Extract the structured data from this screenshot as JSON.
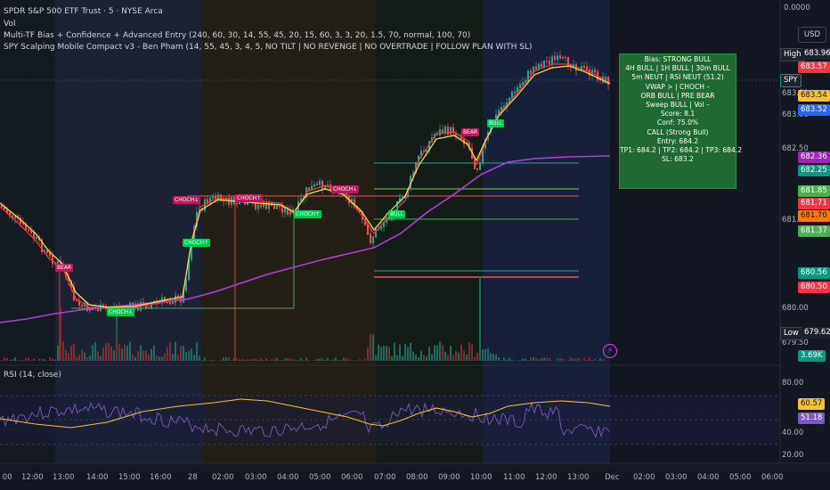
{
  "header": {
    "symbol_title": "SPDR S&P 500 ETF Trust · 5 · NYSE Arca",
    "vol_label": "Vol",
    "indicator1": "Multi-TF Bias + Confidence + Advanced Entry (240, 60, 30, 14, 55, 45, 20, 15, 60, 3, 3, 20, 1.5, 70, normal, 100, 70)",
    "indicator2": "SPY Scalping Mobile Compact v3 - Ben Pham (14, 55, 45, 3, 4, 5, NO TILT | NO REVENGE | NO OVERTRADE | FOLLOW PLAN WITH SL)"
  },
  "top_right": {
    "top_value": "0.0000",
    "currency": "USD"
  },
  "price_axis": {
    "ticks": [
      "683.50",
      "683.00",
      "682.50",
      "681.00",
      "680.00",
      "679.50"
    ],
    "high_label": "High",
    "high_value": "683.96",
    "symbol_label": "SPY",
    "symbol_value": "683.54",
    "low_label": "Low",
    "low_value": "679.62",
    "badges": [
      {
        "value": "683.57",
        "color": "#f23645"
      },
      {
        "value": "683.54",
        "color": "#fbc02d"
      },
      {
        "value": "683.52",
        "color": "#2962ff"
      },
      {
        "value": "682.36",
        "color": "#9c27b0"
      },
      {
        "value": "682.25",
        "color": "#089981"
      },
      {
        "value": "681.85",
        "color": "#4caf50"
      },
      {
        "value": "681.71",
        "color": "#f23645"
      },
      {
        "value": "681.70",
        "color": "#f57c00"
      },
      {
        "value": "681.37",
        "color": "#4caf50"
      },
      {
        "value": "680.56",
        "color": "#089981"
      },
      {
        "value": "680.50",
        "color": "#f23645"
      }
    ],
    "volume_value": "3.69K"
  },
  "signal_panel": {
    "lines": [
      "Bias: STRONG BULL",
      "4H BULL | 1H BULL | 30m BULL",
      "5m NEUT | RSI NEUT (51.2)",
      "VWAP > | CHOCH –",
      "ORB BULL | PRE BEAR",
      "Sweep BULL | Vol –",
      "Score: 8.1",
      "Conf: 75.0%",
      "CALL (Strong Bull)",
      "Entry: 684.2",
      "TP1: 684.2 | TP2: 684.2 | TP3: 684.2",
      "SL: 683.2"
    ],
    "bg_color": "#1e6a32"
  },
  "chart_markers": [
    {
      "label": "BEAR",
      "type": "bear"
    },
    {
      "label": "CHOCH↓",
      "type": "bear"
    },
    {
      "label": "CHOCH↓",
      "type": "bull"
    },
    {
      "label": "CHOCH↑",
      "type": "bull"
    },
    {
      "label": "CHOCH↑",
      "type": "bear"
    },
    {
      "label": "CHOCH↓",
      "type": "bear"
    },
    {
      "label": "CHOCH↑",
      "type": "bull"
    },
    {
      "label": "BULL",
      "type": "bull"
    },
    {
      "label": "BEAR",
      "type": "bear"
    },
    {
      "label": "BULL",
      "type": "bull"
    }
  ],
  "rsi": {
    "label": "RSI (14, close)",
    "ticks": [
      "80.00",
      "40.00",
      "20.00"
    ],
    "value_yellow": "60.57",
    "value_purple": "51.18"
  },
  "time_axis": {
    "labels": [
      "00",
      "12:00",
      "13:00",
      "14:00",
      "15:00",
      "16:00",
      "28",
      "02:00",
      "03:00",
      "04:00",
      "05:00",
      "06:00",
      "07:00",
      "08:00",
      "09:00",
      "10:00",
      "11:00",
      "12:00",
      "13:00",
      "Dec",
      "02:00",
      "03:00",
      "04:00",
      "05:00",
      "06:00"
    ]
  },
  "colors": {
    "bg": "#131722",
    "bull": "#26a69a",
    "bear": "#ef5350",
    "vwap": "#b03fd6",
    "ema_fast": "#f23645",
    "ema_slow": "#fbe84b"
  }
}
